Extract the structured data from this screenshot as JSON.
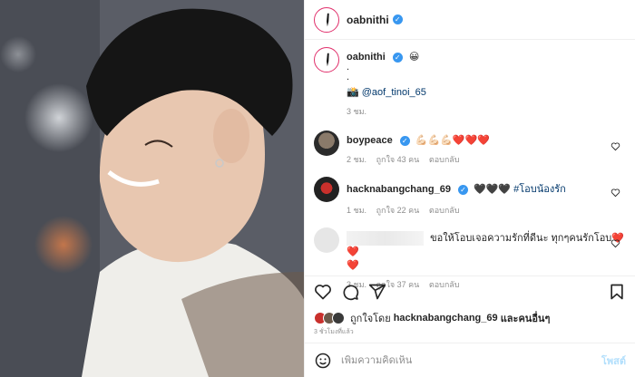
{
  "post": {
    "author": {
      "username": "oabnithi",
      "verified": true
    },
    "caption": {
      "emoji": "😀",
      "line1": ".",
      "line2": ".",
      "camera_icon": "📸",
      "mention": "@aof_tinoi_65",
      "time": "3 ชม."
    },
    "comments": [
      {
        "username": "boypeace",
        "verified": true,
        "text": "💪🏻💪🏻💪🏻❤️❤️❤️",
        "time": "2 ชม.",
        "likes": "ถูกใจ 43 คน",
        "reply": "ตอบกลับ"
      },
      {
        "username": "hacknabangchang_69",
        "verified": true,
        "text": "🖤🖤🖤",
        "tag": "#โอบน้องรัก",
        "time": "1 ชม.",
        "likes": "ถูกใจ 22 คน",
        "reply": "ตอบกลับ"
      },
      {
        "username": "",
        "text": "ขอให้โอบเจอความรักที่ดีนะ ทุกๆคนรักโอบ❤️❤️",
        "text2": "❤️",
        "time": "3 ชม.",
        "likes": "ถูกใจ 37 คน",
        "reply": "ตอบกลับ"
      }
    ],
    "likes_line": {
      "prefix": "ถูกใจโดย",
      "user": "hacknabangchang_69",
      "suffix": "และคนอื่นๆ"
    },
    "posted_ago": "3 ชั่วโมงที่แล้ว",
    "add_comment": {
      "placeholder": "เพิ่มความคิดเห็น",
      "post_label": "โพสต์"
    }
  },
  "colors": {
    "accent": "#3897f0",
    "link": "#00376b",
    "muted": "#8e8e8e",
    "ring": "#e1306c"
  }
}
